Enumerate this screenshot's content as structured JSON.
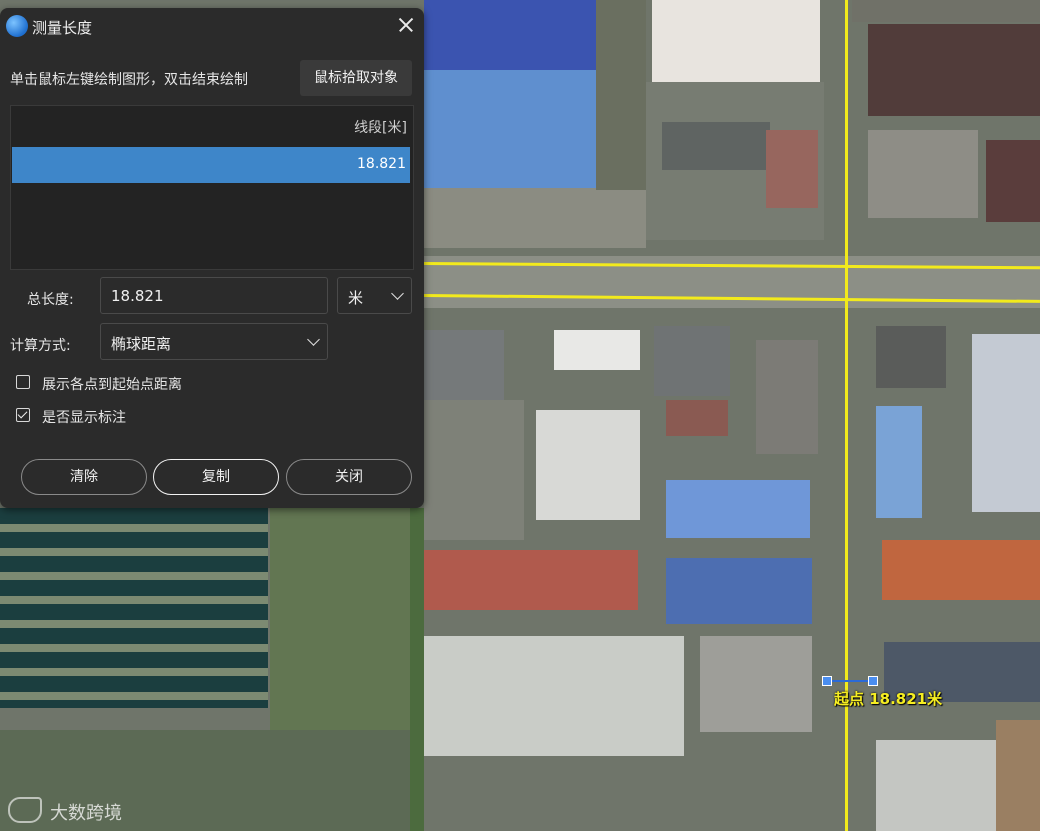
{
  "dialog": {
    "title": "测量长度",
    "hint": "单击鼠标左键绘制图形，双击结束绘制",
    "pick_button": "鼠标拾取对象",
    "table": {
      "header": "线段[米]",
      "rows": [
        {
          "value": "18.821"
        }
      ]
    },
    "total_label": "总长度:",
    "total_value": "18.821",
    "unit_value": "米",
    "method_label": "计算方式:",
    "method_value": "椭球距离",
    "checkbox_distance": {
      "label": "展示各点到起始点距离",
      "checked": false
    },
    "checkbox_annotate": {
      "label": "是否显示标注",
      "checked": true
    },
    "buttons": {
      "clear": "清除",
      "copy": "复制",
      "close": "关闭"
    }
  },
  "measurement": {
    "label": "起点  18.821米"
  },
  "watermark": "大数跨境",
  "colors": {
    "dialog_bg": "#2b2b2b",
    "selected_row": "#3e86c9",
    "road": "#f2ea1c",
    "label": "#f6ee22"
  }
}
